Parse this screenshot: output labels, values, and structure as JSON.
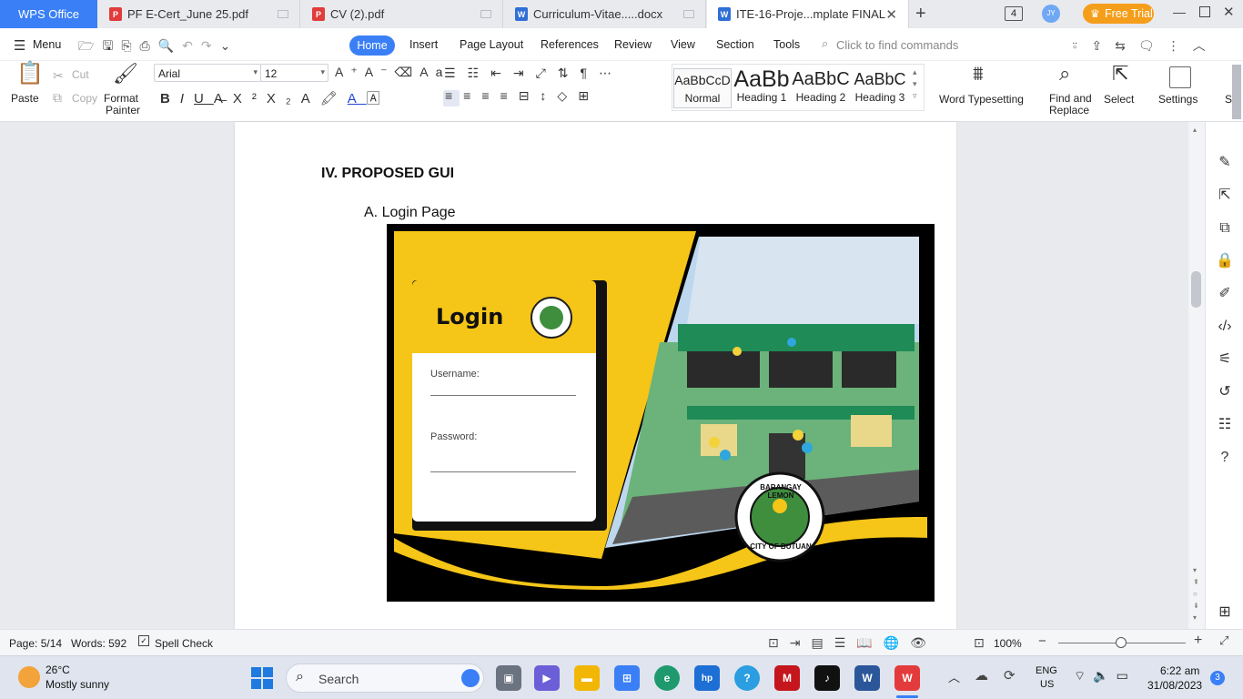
{
  "tabs": {
    "wps": "WPS Office",
    "t1": "PF E-Cert_June 25.pdf",
    "t2": "CV (2).pdf",
    "t3": "Curriculum-Vitae.....docx",
    "t4": "ITE-16-Proje...mplate FINAL",
    "new_tab": "+",
    "count": "4",
    "avatar": "JY",
    "free_trial": "Free Trial"
  },
  "menu": {
    "menu_label": "Menu",
    "items": [
      "Home",
      "Insert",
      "Page Layout",
      "References",
      "Review",
      "View",
      "Section",
      "Tools"
    ],
    "search_placeholder": "Click to find commands"
  },
  "toolbar": {
    "paste": "Paste",
    "cut": "Cut",
    "copy": "Copy",
    "format_painter_1": "Format",
    "format_painter_2": "Painter",
    "font": "Arial",
    "size": "12",
    "styles": [
      {
        "preview": "AaBbCcD",
        "name": "Normal"
      },
      {
        "preview": "AaBb",
        "name": "Heading 1"
      },
      {
        "preview": "AaBbC",
        "name": "Heading 2"
      },
      {
        "preview": "AaBbC",
        "name": "Heading 3"
      }
    ],
    "word_typesetting": "Word Typesetting",
    "find_replace_1": "Find and",
    "find_replace_2": "Replace",
    "select": "Select",
    "settings": "Settings",
    "overflow": "S"
  },
  "document": {
    "heading": "IV. PROPOSED GUI",
    "subheading": "A. Login Page",
    "login_title": "Login",
    "username_label": "Username:",
    "password_label": "Password:",
    "seal_top_text": "BARANGAY LEMON",
    "seal_bottom_text": "CITY OF BUTUAN"
  },
  "status": {
    "page": "Page: 5/14",
    "words": "Words: 592",
    "spell": "Spell Check",
    "zoom": "100%"
  },
  "taskbar": {
    "temp": "26°C",
    "weather": "Mostly sunny",
    "search": "Search",
    "lang_1": "ENG",
    "lang_2": "US",
    "time": "6:22 am",
    "date": "31/08/2023",
    "notif": "3"
  },
  "colors": {
    "accent": "#3a7ff6",
    "gui_yellow": "#f5c518",
    "gui_black": "#000000",
    "free_trial": "#f59e1b"
  }
}
